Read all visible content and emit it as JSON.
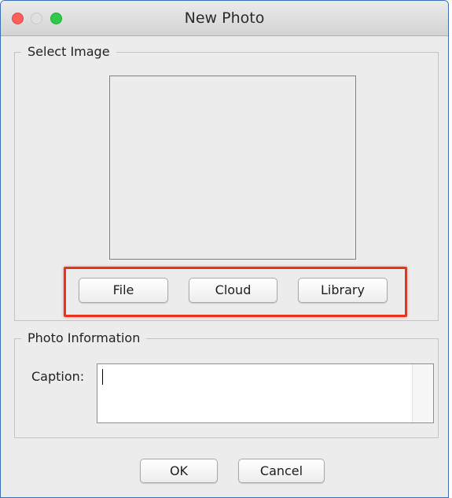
{
  "window": {
    "title": "New Photo",
    "controls": [
      "close",
      "minimize",
      "maximize"
    ]
  },
  "select_image": {
    "legend": "Select Image",
    "buttons": {
      "file": "File",
      "cloud": "Cloud",
      "library": "Library"
    },
    "highlight_color": "#e8341f"
  },
  "photo_information": {
    "legend": "Photo Information",
    "caption_label": "Caption:",
    "caption_value": ""
  },
  "footer": {
    "ok_label": "OK",
    "cancel_label": "Cancel"
  },
  "colors": {
    "close": "#fc5f57",
    "minimize": "#e0e0e0",
    "maximize": "#34c84a",
    "window_border": "#3b6fb3",
    "background": "#ececec"
  }
}
